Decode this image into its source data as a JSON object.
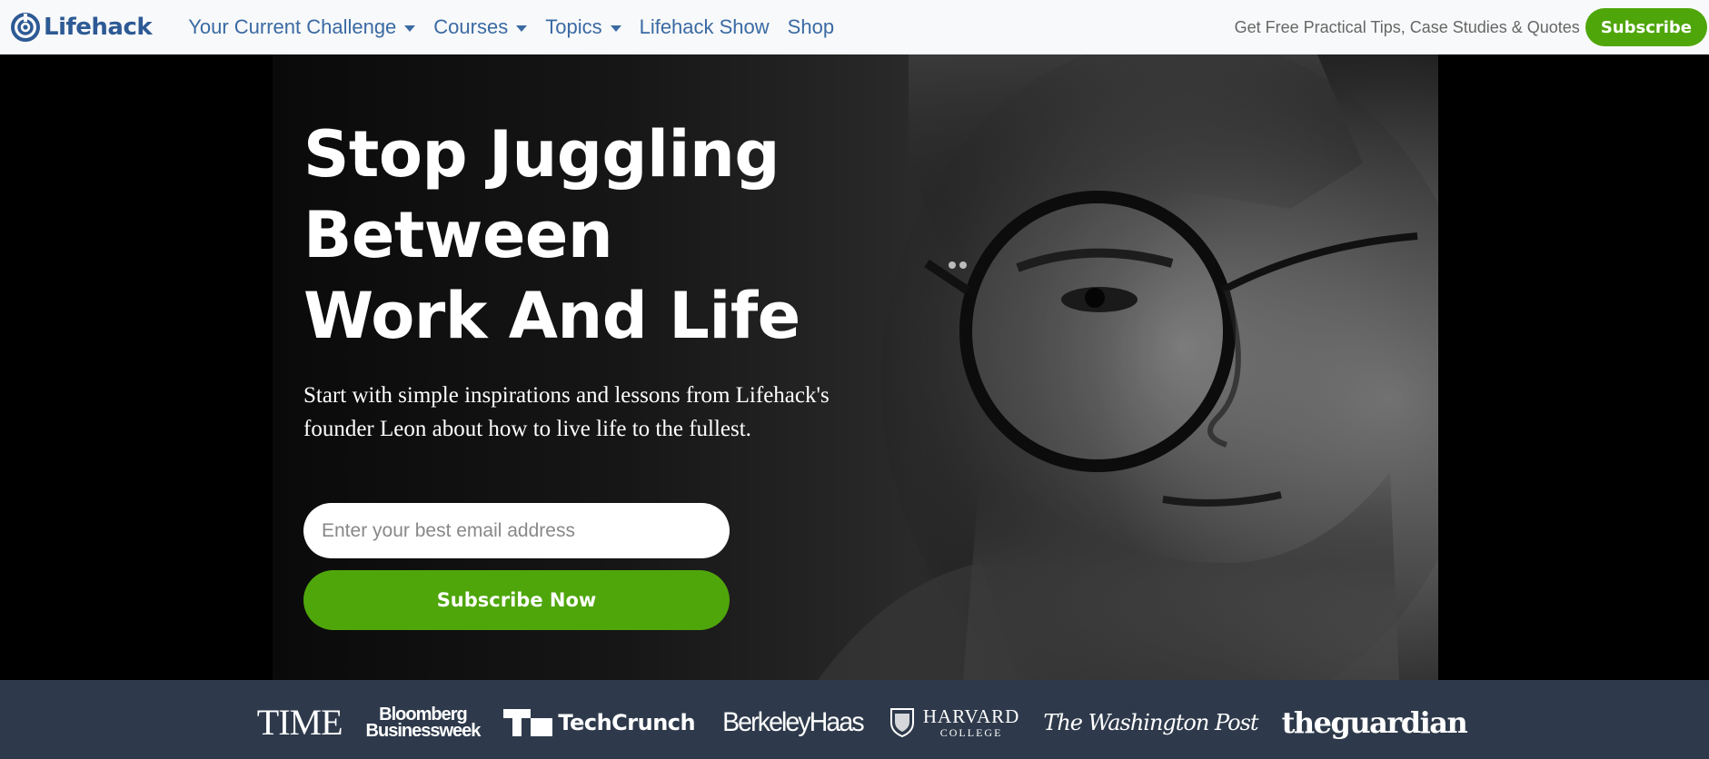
{
  "header": {
    "brand": "Lifehack",
    "nav_items": [
      {
        "label": "Your Current Challenge",
        "dropdown": true
      },
      {
        "label": "Courses",
        "dropdown": true
      },
      {
        "label": "Topics",
        "dropdown": true
      },
      {
        "label": "Lifehack Show",
        "dropdown": false
      },
      {
        "label": "Shop",
        "dropdown": false
      }
    ],
    "tagline": "Get Free Practical Tips, Case Studies & Quotes",
    "subscribe_label": "Subscribe"
  },
  "hero": {
    "title_lines": [
      "Stop Juggling",
      "Between",
      "Work And Life"
    ],
    "subtitle": "Start with simple inspirations and lessons from Lifehack's founder Leon about how to live life to the fullest.",
    "email_placeholder": "Enter your best email address",
    "email_value": "",
    "cta_label": "Subscribe Now"
  },
  "press": {
    "time": "TIME",
    "bloomberg_line1": "Bloomberg",
    "bloomberg_line2": "Businessweek",
    "techcrunch": "TechCrunch",
    "berkeley": "BerkeleyHaas",
    "harvard_line1": "HARVARD",
    "harvard_line2": "COLLEGE",
    "washington_post": "The Washington Post",
    "guardian": "theguardian"
  },
  "colors": {
    "brand_blue": "#2d5a95",
    "nav_link": "#3a6aa3",
    "accent_green": "#4fa60a",
    "press_bar": "#2e3a4b"
  },
  "icons": {
    "logo": "lifehack-logo-icon",
    "dropdown": "chevron-down-icon"
  }
}
